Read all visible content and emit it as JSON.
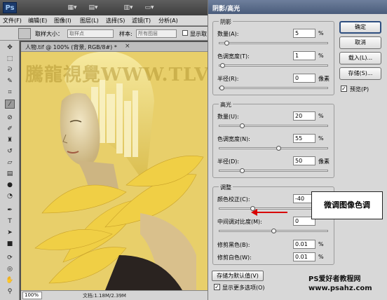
{
  "app": {
    "logo": "Ps",
    "menus": [
      "文件(F)",
      "编辑(E)",
      "图像(I)",
      "图层(L)",
      "选择(S)",
      "滤镜(T)",
      "分析(A)"
    ]
  },
  "options_bar": {
    "sample_size_label": "取样大小：",
    "sample_size_value": "取样点",
    "sample_label": "样本:",
    "sample_value": "所有图层",
    "show_ring_label": "显示取"
  },
  "document": {
    "tab_label": "人物.tif @ 100% (背景, RGB/8#) *",
    "close_glyph": "×",
    "watermark": "騰龍視覺WWW.TLVI.NET",
    "zoom": "100%",
    "doc_size": "文档:1.18M/2.39M"
  },
  "dialog": {
    "title": "阴影/高光",
    "shadows": {
      "title": "阴影",
      "amount_label": "数量(A):",
      "amount": "5",
      "amount_unit": "%",
      "amount_pct": 5,
      "tonal_label": "色调宽度(T):",
      "tonal": "1",
      "tonal_unit": "%",
      "tonal_pct": 1,
      "radius_label": "半径(R):",
      "radius": "0",
      "radius_unit": "像素",
      "radius_pct": 0
    },
    "highlights": {
      "title": "高光",
      "amount_label": "数量(U):",
      "amount": "20",
      "amount_unit": "%",
      "amount_pct": 20,
      "tonal_label": "色调宽度(N):",
      "tonal": "55",
      "tonal_unit": "%",
      "tonal_pct": 55,
      "radius_label": "半径(D):",
      "radius": "50",
      "radius_unit": "像素",
      "radius_pct": 20
    },
    "adjustments": {
      "title": "调整",
      "color_label": "颜色校正(C):",
      "color": "-40",
      "color_pct": 30,
      "midtone_label": "中间调对比度(M):",
      "midtone": "0",
      "midtone_pct": 50,
      "black_clip_label": "修剪黑色(B):",
      "black_clip": "0.01",
      "black_clip_unit": "%",
      "white_clip_label": "修剪白色(W):",
      "white_clip": "0.01",
      "white_clip_unit": "%"
    },
    "buttons": {
      "ok": "确定",
      "cancel": "取消",
      "load": "载入(L)...",
      "save": "存储(S)...",
      "preview": "预览(P)",
      "preview_checked": true
    },
    "save_default": "存储为默认值(V)",
    "more_options": "显示更多选项(O)",
    "more_options_checked": true
  },
  "annotation": {
    "callout": "微调图像色调",
    "arrow_color": "#d80000"
  },
  "footer": {
    "line1": "PS爱好者教程网",
    "line2": "www.psahz.com"
  }
}
